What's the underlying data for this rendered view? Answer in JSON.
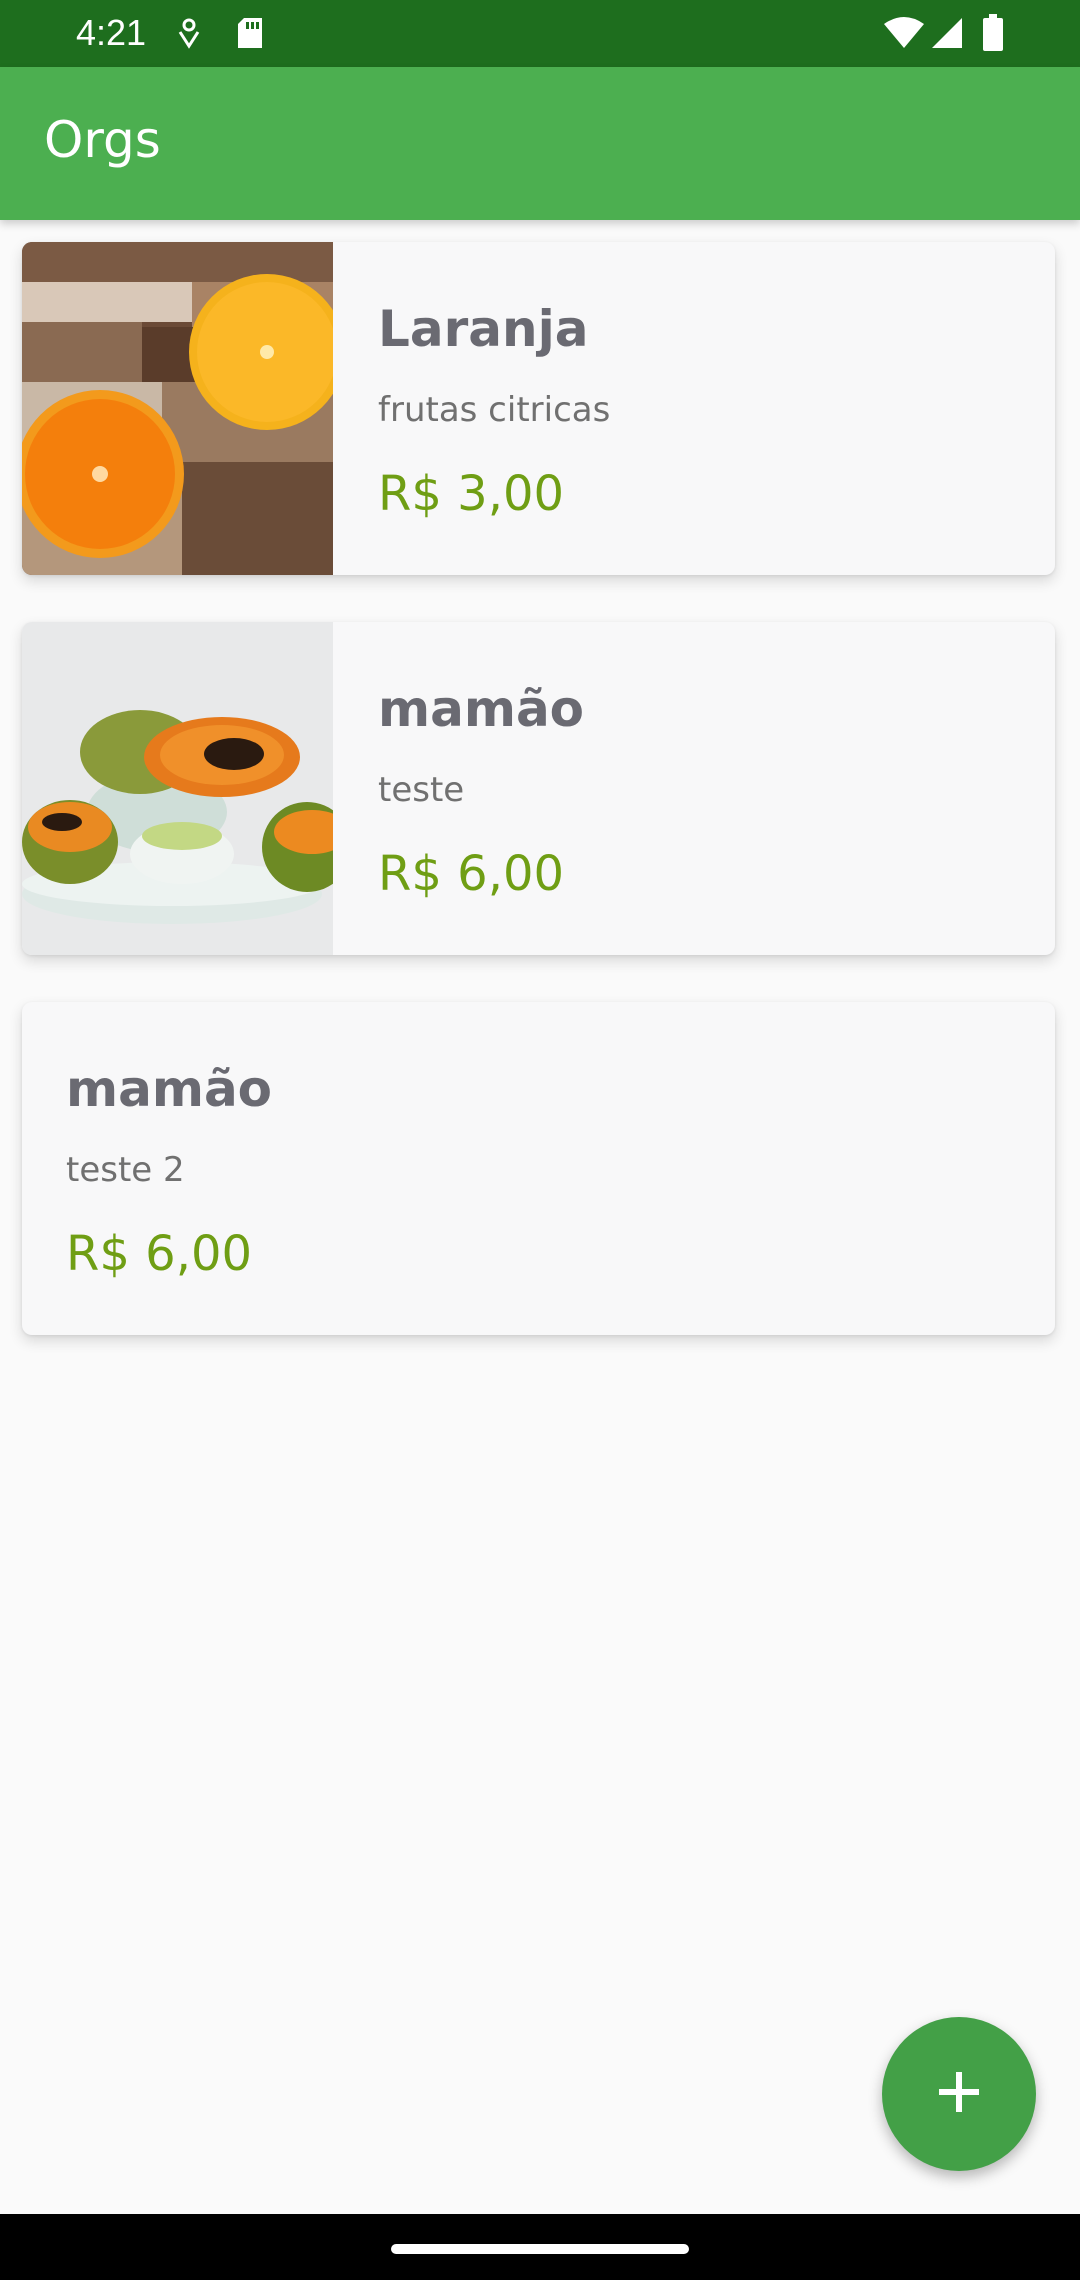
{
  "status_bar": {
    "time": "4:21",
    "icons": [
      "notification-icon",
      "sd-card-icon",
      "wifi-icon",
      "signal-icon",
      "battery-icon"
    ]
  },
  "app_bar": {
    "title": "Orgs"
  },
  "products": [
    {
      "name": "Laranja",
      "description": "frutas citricas",
      "price": "R$ 3,00",
      "image": "oranges-photo"
    },
    {
      "name": "mamão",
      "description": "teste",
      "price": "R$ 6,00",
      "image": "papaya-photo"
    },
    {
      "name": "mamão",
      "description": "teste 2",
      "price": "R$ 6,00",
      "image": null
    }
  ],
  "fab": {
    "icon": "plus-icon"
  },
  "colors": {
    "status_bar": "#1e6e1e",
    "app_bar": "#4caf50",
    "fab": "#43a047",
    "price": "#6f9e14",
    "name": "#6a6a72",
    "background": "#fafafa"
  }
}
